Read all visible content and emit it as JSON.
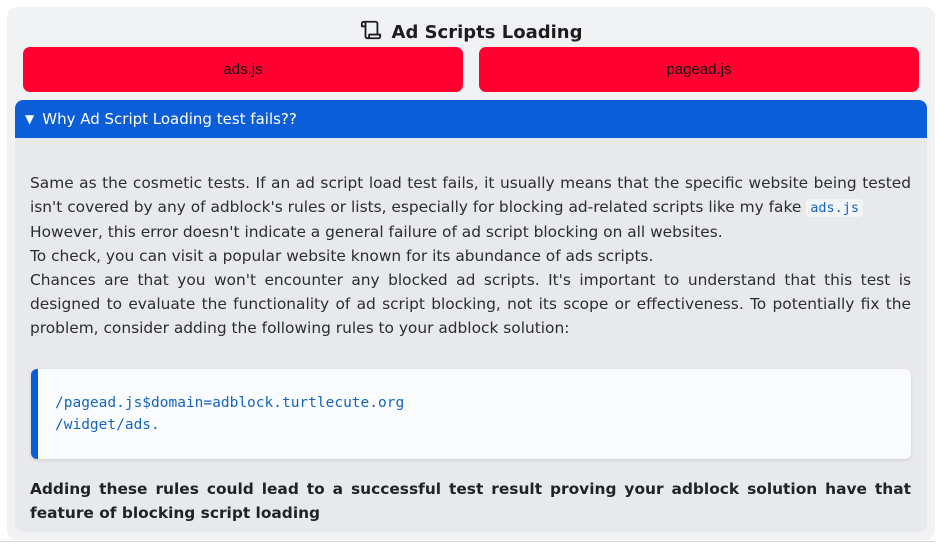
{
  "section": {
    "title": "Ad Scripts Loading",
    "title_icon": "scroll-icon"
  },
  "buttons": [
    {
      "label": "ads.js",
      "color": "#ff0030"
    },
    {
      "label": "pagead.js",
      "color": "#ff0030"
    }
  ],
  "details": {
    "summary": "Why Ad Script Loading test fails??",
    "summary_color": "#0b5ed7",
    "paragraph_part1": "Same as the cosmetic tests. If an ad script load test fails, it usually means that the specific website being tested isn't covered by any of adblock's rules or lists, especially for blocking ad-related scripts like my fake",
    "inline_code": "ads.js",
    "line2": "However, this error doesn't indicate a general failure of ad script blocking on all websites.",
    "line3": "To check, you can visit a popular website known for its abundance of ads scripts.",
    "line4": "Chances are that you won't encounter any blocked ad scripts. It's important to understand that this test is designed to evaluate the functionality of ad script blocking, not its scope or effectiveness. To potentially fix the problem, consider adding the following rules to your adblock solution:",
    "rules": [
      "/pagead.js$domain=adblock.turtlecute.org",
      "/widget/ads."
    ],
    "conclusion": "Adding these rules could lead to a successful test result proving your adblock solution have that feature of blocking script loading"
  }
}
